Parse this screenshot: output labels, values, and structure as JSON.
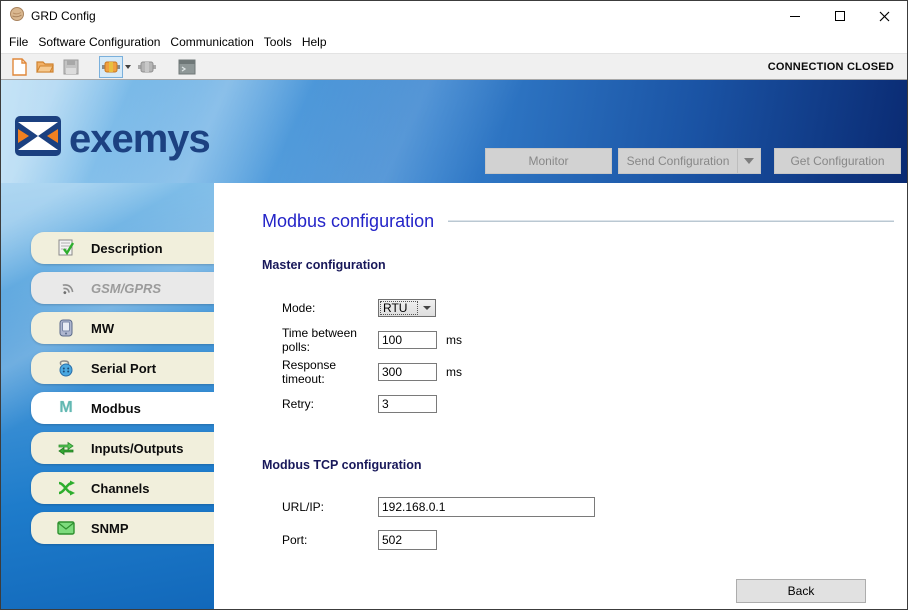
{
  "window": {
    "title": "GRD Config",
    "controls": [
      "minimize",
      "maximize",
      "close"
    ]
  },
  "menu": {
    "items": [
      "File",
      "Software Configuration",
      "Communication",
      "Tools",
      "Help"
    ]
  },
  "toolbar": {
    "status": "CONNECTION CLOSED",
    "icons": [
      "new-file",
      "open-folder",
      "save",
      "connect",
      "connect-dropdown",
      "disconnect",
      "terminal"
    ]
  },
  "brand": {
    "name": "exemys"
  },
  "actions": {
    "monitor": "Monitor",
    "send": "Send Configuration",
    "get": "Get Configuration"
  },
  "sidebar": {
    "items": [
      {
        "label": "Description",
        "icon": "description-icon",
        "state": "normal"
      },
      {
        "label": "GSM/GPRS",
        "icon": "gsm-gprs-icon",
        "state": "disabled"
      },
      {
        "label": "MW",
        "icon": "mw-icon",
        "state": "normal"
      },
      {
        "label": "Serial Port",
        "icon": "serial-port-icon",
        "state": "normal"
      },
      {
        "label": "Modbus",
        "icon": "modbus-icon",
        "state": "selected"
      },
      {
        "label": "Inputs/Outputs",
        "icon": "inputs-outputs-icon",
        "state": "normal"
      },
      {
        "label": "Channels",
        "icon": "channels-icon",
        "state": "normal"
      },
      {
        "label": "SNMP",
        "icon": "snmp-icon",
        "state": "normal"
      }
    ]
  },
  "form": {
    "title": "Modbus configuration",
    "master": {
      "title": "Master configuration",
      "mode_label": "Mode:",
      "mode_value": "RTU",
      "polls_label": "Time between polls:",
      "polls_value": "100",
      "polls_unit": "ms",
      "timeout_label": "Response timeout:",
      "timeout_value": "300",
      "timeout_unit": "ms",
      "retry_label": "Retry:",
      "retry_value": "3"
    },
    "tcp": {
      "title": "Modbus TCP configuration",
      "url_label": "URL/IP:",
      "url_value": "192.168.0.1",
      "port_label": "Port:",
      "port_value": "502"
    },
    "back": "Back"
  },
  "colors": {
    "heading_blue": "#2424c8",
    "logo_navy": "#1c4181",
    "banner_light": "#a7d5f2",
    "banner_dark": "#0a2a72",
    "pill_cream": "#f1efdc",
    "pill_selected": "#ffffff",
    "pill_disabled": "#e9e9e9",
    "icon_green": "#2eae2e",
    "logo_orange": "#f08020"
  }
}
